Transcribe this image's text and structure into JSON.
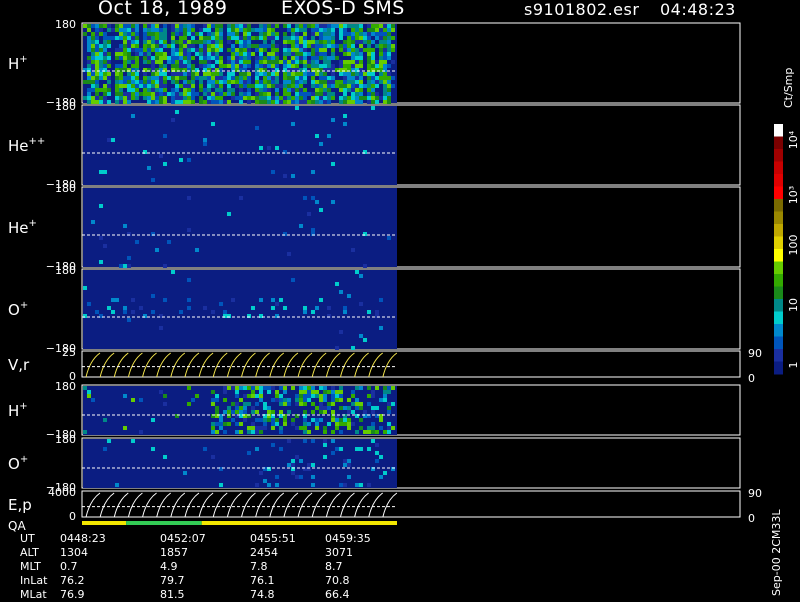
{
  "header": {
    "date": "Oct 18, 1989",
    "instrument": "EXOS-D SMS",
    "file": "s9101802.esr",
    "time": "04:48:23"
  },
  "colors": {
    "background": "#000000",
    "spectrogram_bg": "#0b1d82",
    "trace": "#ffffff",
    "curve": "#f2e34c"
  },
  "panels": [
    {
      "id": "h-plus",
      "label": "H",
      "sup": "+",
      "ymax": "180",
      "ymin": "−180",
      "kind": "spectrogram",
      "density": 0.9
    },
    {
      "id": "he-pp",
      "label": "He",
      "sup": "++",
      "ymax": "180",
      "ymin": "−180",
      "kind": "spectrogram",
      "density": 0.02
    },
    {
      "id": "he-plus",
      "label": "He",
      "sup": "+",
      "ymax": "180",
      "ymin": "−180",
      "kind": "spectrogram",
      "density": 0.03
    },
    {
      "id": "o-plus",
      "label": "O",
      "sup": "+",
      "ymax": "180",
      "ymin": "−180",
      "kind": "spectrogram",
      "density": 0.1
    },
    {
      "id": "v-r",
      "label": "V,r",
      "sup": "",
      "ymax": "25",
      "ymin": "0",
      "kind": "curves",
      "right_top": "90",
      "right_bottom": "0"
    },
    {
      "id": "h-plus-2",
      "label": "H",
      "sup": "+",
      "ymax": "180",
      "ymin": "−180",
      "kind": "spectrogram",
      "density": 0.5
    },
    {
      "id": "o-plus-2",
      "label": "O",
      "sup": "+",
      "ymax": "180",
      "ymin": "−180",
      "kind": "spectrogram",
      "density": 0.15
    },
    {
      "id": "e-p",
      "label": "E,p",
      "sup": "",
      "ymax": "4000",
      "ymin": "0",
      "kind": "curves",
      "right_top": "90",
      "right_bottom": "0"
    }
  ],
  "qa": {
    "label": "QA",
    "segments": [
      {
        "color": "#f2e600",
        "fraction": 0.14
      },
      {
        "color": "#33cc55",
        "fraction": 0.24
      },
      {
        "color": "#f2e600",
        "fraction": 0.62
      }
    ]
  },
  "colorbar": {
    "units": "Ct/Smp",
    "ticks": [
      "10⁴",
      "10³",
      "100",
      "10",
      "1"
    ],
    "colors": [
      "#ffffff",
      "#7a0000",
      "#a00000",
      "#c80000",
      "#e00000",
      "#ff0000",
      "#7a6a00",
      "#9a8800",
      "#bfa800",
      "#e0d000",
      "#ffff00",
      "#66cc00",
      "#33aa00",
      "#1a8a1a",
      "#008888",
      "#00cccc",
      "#0088cc",
      "#0055bb",
      "#1a2fa0",
      "#0b1d82"
    ]
  },
  "footer": {
    "rows": [
      {
        "label": "UT",
        "values": [
          "0448:23",
          "0452:07",
          "0455:51",
          "0459:35"
        ]
      },
      {
        "label": "ALT",
        "values": [
          "1304",
          "1857",
          "2454",
          "3071"
        ]
      },
      {
        "label": "MLT",
        "values": [
          "0.7",
          "4.9",
          "7.8",
          "8.7"
        ]
      },
      {
        "label": "InLat",
        "values": [
          "76.2",
          "79.7",
          "76.1",
          "70.8"
        ]
      },
      {
        "label": "MLat",
        "values": [
          "76.9",
          "81.5",
          "74.8",
          "66.4"
        ]
      }
    ],
    "version": "Sep-00 2CM33L"
  },
  "chart_data": {
    "type": "heatmap",
    "title": "Oct 18, 1989   EXOS-D SMS",
    "x": [
      "0448:23",
      "0452:07",
      "0455:51",
      "0459:35"
    ],
    "xlabel": "UT",
    "series": [
      {
        "name": "H+",
        "ylim": [
          -180,
          180
        ]
      },
      {
        "name": "He++",
        "ylim": [
          -180,
          180
        ]
      },
      {
        "name": "He+",
        "ylim": [
          -180,
          180
        ]
      },
      {
        "name": "O+",
        "ylim": [
          -180,
          180
        ]
      },
      {
        "name": "V,r",
        "ylim": [
          0,
          25
        ]
      },
      {
        "name": "H+",
        "ylim": [
          -180,
          180
        ]
      },
      {
        "name": "O+",
        "ylim": [
          -180,
          180
        ]
      },
      {
        "name": "E,p",
        "ylim": [
          0,
          4000
        ]
      }
    ],
    "colorbar_label": "Ct/Smp",
    "colorbar_ticks": [
      "1",
      "10",
      "100",
      "10³",
      "10⁴"
    ]
  }
}
